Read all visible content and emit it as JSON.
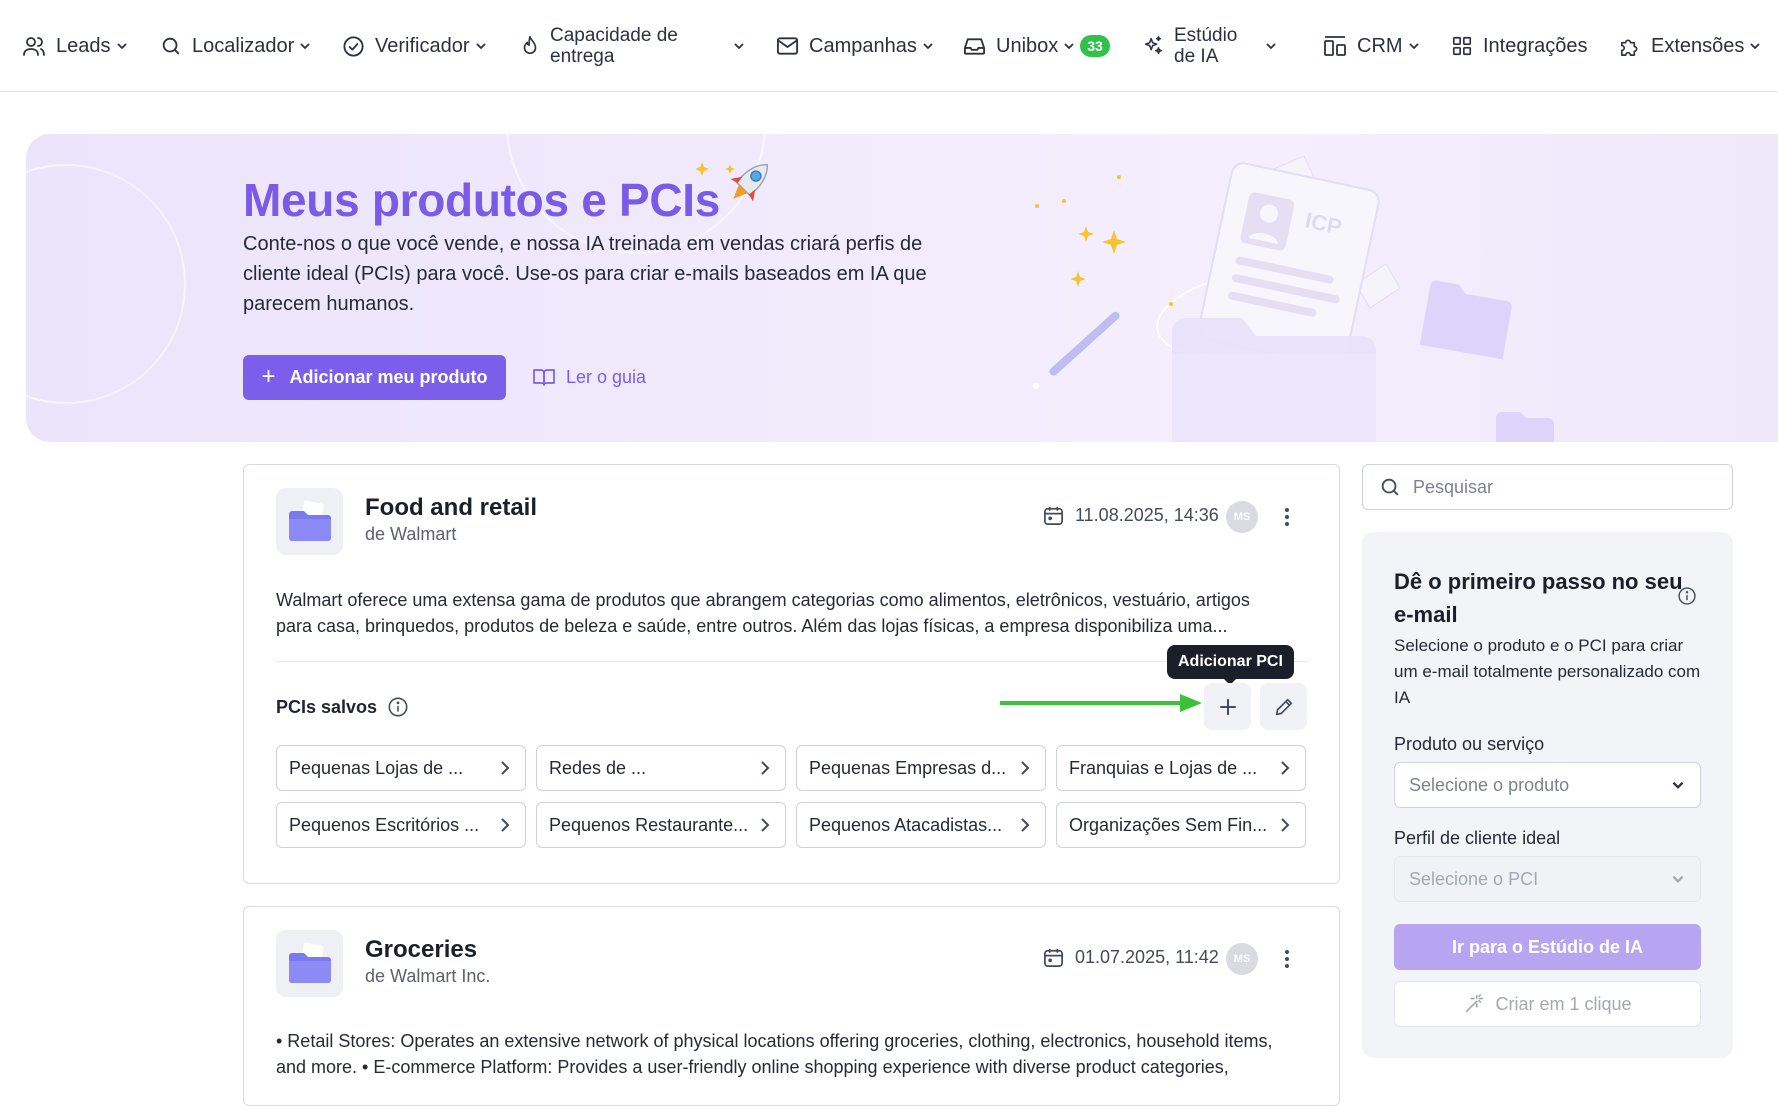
{
  "nav": {
    "leads": "Leads",
    "localizador": "Localizador",
    "verificador": "Verificador",
    "capacidade": "Capacidade de entrega",
    "campanhas": "Campanhas",
    "unibox": "Unibox",
    "unibox_badge": "33",
    "estudio": "Estúdio de IA",
    "crm": "CRM",
    "integracoes": "Integrações",
    "extensoes": "Extensões"
  },
  "hero": {
    "title": "Meus produtos e PCIs",
    "description": "Conte-nos o que você vende, e nossa IA treinada em vendas criará perfis de cliente ideal (PCIs) para você. Use-os para criar e-mails baseados em IA que parecem humanos.",
    "add_button": "Adicionar meu produto",
    "guide_link": "Ler o guia",
    "illustration_label": "ICP"
  },
  "products": [
    {
      "title": "Food and retail",
      "company": "de Walmart",
      "date": "11.08.2025, 14:36",
      "avatar": "MS",
      "description": "Walmart oferece uma extensa gama de produtos que abrangem categorias como alimentos, eletrônicos, vestuário, artigos para casa, brinquedos, produtos de beleza e saúde, entre outros. Além das lojas físicas, a empresa disponibiliza uma...",
      "saved_label": "PCIs salvos",
      "tooltip": "Adicionar PCI",
      "pcis": [
        "Pequenas Lojas de ...",
        "Redes de ...",
        "Pequenas Empresas d...",
        "Franquias e Lojas de ...",
        "Pequenos Escritórios ...",
        "Pequenos Restaurante...",
        "Pequenos Atacadistas...",
        "Organizações Sem Fin..."
      ]
    },
    {
      "title": "Groceries",
      "company": "de Walmart Inc.",
      "date": "01.07.2025, 11:42",
      "avatar": "MS",
      "description": "• Retail Stores: Operates an extensive network of physical locations offering groceries, clothing, electronics, household items, and more. • E-commerce Platform: Provides a user-friendly online shopping experience with diverse product categories, easy..."
    }
  ],
  "sidebar": {
    "search_placeholder": "Pesquisar",
    "title": "Dê o primeiro passo no seu e-mail",
    "description": "Selecione o produto e o PCI para criar um e-mail totalmente personalizado com IA",
    "product_label": "Produto ou serviço",
    "product_placeholder": "Selecione o produto",
    "pci_label": "Perfil de cliente ideal",
    "pci_placeholder": "Selecione o PCI",
    "studio_button": "Ir para o Estúdio de IA",
    "one_click_button": "Criar em 1 clique"
  },
  "colors": {
    "accent": "#7b5ee9",
    "badge": "#2fc14a",
    "arrow": "#3cc13b"
  }
}
